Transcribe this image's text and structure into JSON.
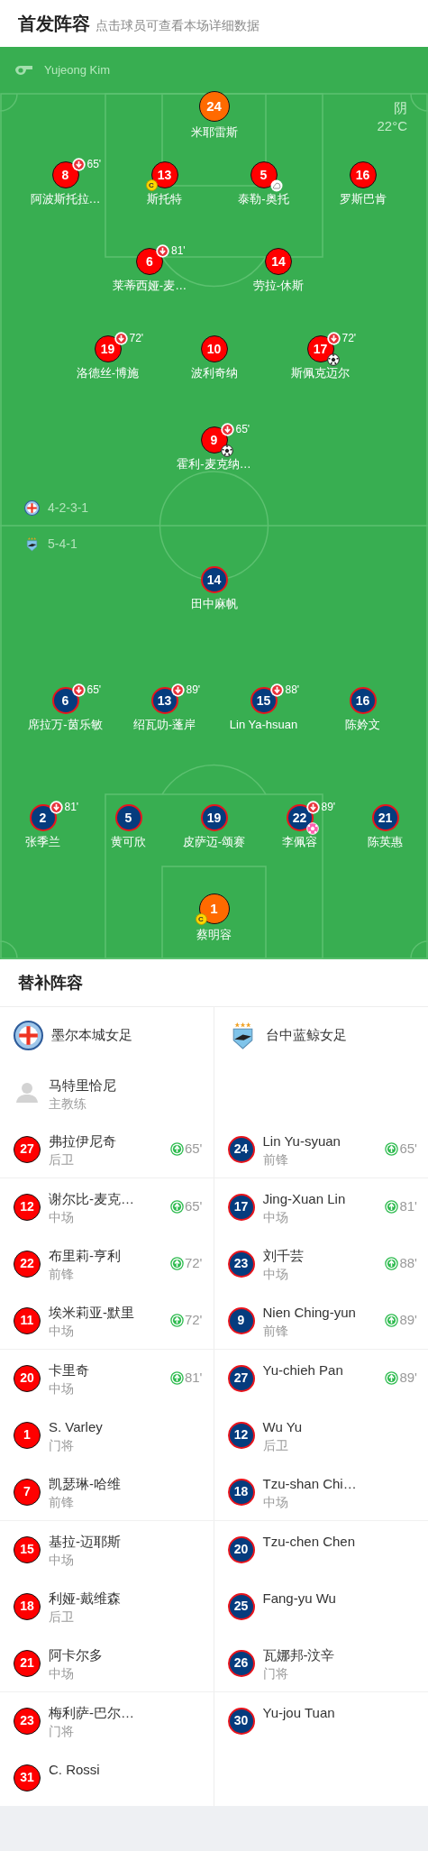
{
  "header": {
    "title": "首发阵容",
    "subtitle": "点击球员可查看本场详细数据"
  },
  "referee": {
    "name": "Yujeong Kim"
  },
  "weather": {
    "condition": "阴",
    "temperature": "22°C"
  },
  "teams": [
    {
      "kind": "home",
      "name": "墨尔本城女足",
      "formation": "4-2-3-1",
      "lines": [
        [
          {
            "number": "24",
            "name": "米耶雷斯",
            "kind": "goalkeeper"
          }
        ],
        [
          {
            "number": "8",
            "name": "阿波斯托拉…",
            "kind": "outfield",
            "sub_out_time": "65'"
          },
          {
            "number": "13",
            "name": "斯托特",
            "kind": "outfield",
            "captain_badge": "C"
          },
          {
            "number": "5",
            "name": "泰勒-奥托",
            "kind": "outfield",
            "event": {
              "kind": "assist"
            }
          },
          {
            "number": "16",
            "name": "罗斯巴肯",
            "kind": "outfield"
          }
        ],
        [
          {
            "number": "6",
            "name": "莱蒂西娅-麦…",
            "kind": "outfield",
            "sub_out_time": "81'"
          },
          {
            "number": "14",
            "name": "劳拉-休斯",
            "kind": "outfield"
          }
        ],
        [
          {
            "number": "19",
            "name": "洛德丝-博施",
            "kind": "outfield",
            "sub_out_time": "72'"
          },
          {
            "number": "10",
            "name": "波利奇纳",
            "kind": "outfield"
          },
          {
            "number": "17",
            "name": "斯佩克迈尔",
            "kind": "outfield",
            "sub_out_time": "72'",
            "event": {
              "kind": "goal"
            }
          }
        ],
        [
          {
            "number": "9",
            "name": "霍利-麦克纳…",
            "kind": "outfield",
            "sub_out_time": "65'",
            "event": {
              "kind": "goal"
            }
          }
        ]
      ],
      "coach": {
        "name": "马特里恰尼",
        "role": "主教练"
      },
      "substitutes": [
        {
          "number": "27",
          "name": "弗拉伊尼奇",
          "position": "后卫",
          "sub_in_time": "65'"
        },
        {
          "number": "12",
          "name": "谢尔比-麦克…",
          "position": "中场",
          "sub_in_time": "65'"
        },
        {
          "number": "22",
          "name": "布里莉-亨利",
          "position": "前锋",
          "sub_in_time": "72'"
        },
        {
          "number": "11",
          "name": "埃米莉亚-默里",
          "position": "中场",
          "sub_in_time": "72'"
        },
        {
          "number": "20",
          "name": "卡里奇",
          "position": "中场",
          "sub_in_time": "81'"
        },
        {
          "number": "1",
          "name": "S. Varley",
          "position": "门将"
        },
        {
          "number": "7",
          "name": "凯瑟琳-哈维",
          "position": "前锋"
        },
        {
          "number": "15",
          "name": "基拉-迈耶斯",
          "position": "中场"
        },
        {
          "number": "18",
          "name": "利娅-戴维森",
          "position": "后卫"
        },
        {
          "number": "21",
          "name": "阿卡尔多",
          "position": "中场"
        },
        {
          "number": "23",
          "name": "梅利萨-巴尔…",
          "position": "门将"
        },
        {
          "number": "31",
          "name": "C. Rossi"
        }
      ]
    },
    {
      "kind": "away",
      "name": "台中蓝鲸女足",
      "formation": "5-4-1",
      "lines": [
        [
          {
            "number": "14",
            "name": "田中麻帆",
            "kind": "outfield"
          }
        ],
        [
          {
            "number": "6",
            "name": "席拉万-茵乐敏",
            "kind": "outfield",
            "sub_out_time": "65'"
          },
          {
            "number": "13",
            "name": "绍瓦叻-蓬岸",
            "kind": "outfield",
            "sub_out_time": "89'"
          },
          {
            "number": "15",
            "name": "Lin Ya-hsuan",
            "kind": "outfield",
            "sub_out_time": "88'"
          },
          {
            "number": "16",
            "name": "陈妗文",
            "kind": "outfield"
          }
        ],
        [
          {
            "number": "2",
            "name": "张季兰",
            "kind": "outfield",
            "sub_out_time": "81'"
          },
          {
            "number": "5",
            "name": "黄可欣",
            "kind": "outfield"
          },
          {
            "number": "19",
            "name": "皮萨迈-颂赛",
            "kind": "outfield"
          },
          {
            "number": "22",
            "name": "李佩容",
            "kind": "outfield",
            "sub_out_time": "89'",
            "event": {
              "kind": "own_goal"
            }
          },
          {
            "number": "21",
            "name": "陈英惠",
            "kind": "outfield"
          }
        ],
        [
          {
            "number": "1",
            "name": "蔡明容",
            "kind": "goalkeeper",
            "captain_badge": "C"
          }
        ]
      ],
      "substitutes": [
        {
          "number": "24",
          "name": "Lin Yu-syuan",
          "position": "前锋",
          "sub_in_time": "65'"
        },
        {
          "number": "17",
          "name": "Jing-Xuan Lin",
          "position": "中场",
          "sub_in_time": "81'"
        },
        {
          "number": "23",
          "name": "刘千芸",
          "position": "中场",
          "sub_in_time": "88'"
        },
        {
          "number": "9",
          "name": "Nien Ching-yun",
          "position": "前锋",
          "sub_in_time": "89'"
        },
        {
          "number": "27",
          "name": "Yu-chieh Pan",
          "sub_in_time": "89'"
        },
        {
          "number": "12",
          "name": "Wu Yu",
          "position": "后卫"
        },
        {
          "number": "18",
          "name": "Tzu-shan Chi…",
          "position": "中场"
        },
        {
          "number": "20",
          "name": "Tzu-chen Chen"
        },
        {
          "number": "25",
          "name": "Fang-yu Wu"
        },
        {
          "number": "26",
          "name": "瓦娜邦-汶辛",
          "position": "门将"
        },
        {
          "number": "30",
          "name": "Yu-jou Tuan"
        }
      ]
    }
  ],
  "subs_title": "替补阵容"
}
